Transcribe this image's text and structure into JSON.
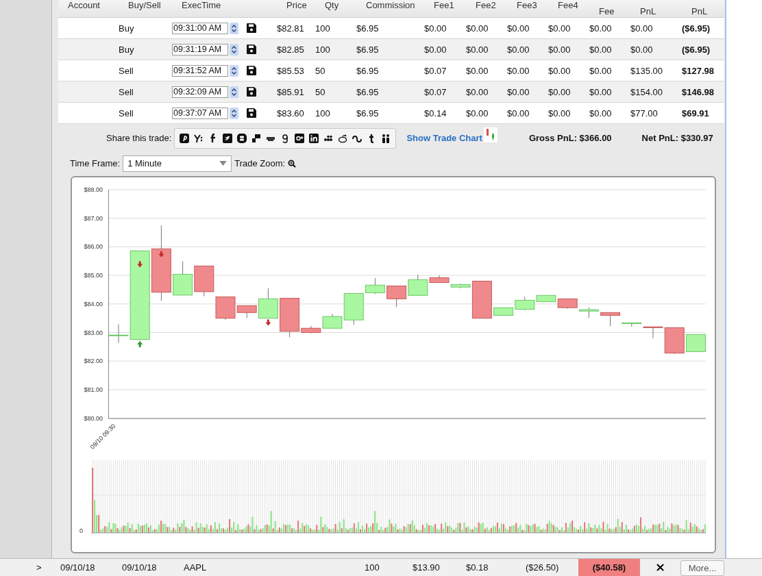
{
  "trades_table": {
    "columns": [
      "Account",
      "Buy/Sell",
      "ExecTime",
      "Price",
      "Qty",
      "Commission",
      "Fee1",
      "Fee2",
      "Fee3",
      "Fee4",
      "Fee",
      "PnL",
      "PnL"
    ],
    "rows": [
      {
        "side": "Buy",
        "time": "09:31:00 AM",
        "price": "$82.81",
        "qty": "100",
        "commission": "$6.95",
        "fee1": "$0.00",
        "fee2": "$0.00",
        "fee3": "$0.00",
        "fee4": "$0.00",
        "fee": "$0.00",
        "pnl": "$0.00",
        "net_pnl": "($6.95)"
      },
      {
        "side": "Buy",
        "time": "09:31:19 AM",
        "price": "$82.85",
        "qty": "100",
        "commission": "$6.95",
        "fee1": "$0.00",
        "fee2": "$0.00",
        "fee3": "$0.00",
        "fee4": "$0.00",
        "fee": "$0.00",
        "pnl": "$0.00",
        "net_pnl": "($6.95)"
      },
      {
        "side": "Sell",
        "time": "09:31:52 AM",
        "price": "$85.53",
        "qty": "50",
        "commission": "$6.95",
        "fee1": "$0.07",
        "fee2": "$0.00",
        "fee3": "$0.00",
        "fee4": "$0.00",
        "fee": "$0.00",
        "pnl": "$135.00",
        "net_pnl": "$127.98"
      },
      {
        "side": "Sell",
        "time": "09:32:09 AM",
        "price": "$85.91",
        "qty": "50",
        "commission": "$6.95",
        "fee1": "$0.07",
        "fee2": "$0.00",
        "fee3": "$0.00",
        "fee4": "$0.00",
        "fee": "$0.00",
        "pnl": "$154.00",
        "net_pnl": "$146.98"
      },
      {
        "side": "Sell",
        "time": "09:37:07 AM",
        "price": "$83.60",
        "qty": "100",
        "commission": "$6.95",
        "fee1": "$0.14",
        "fee2": "$0.00",
        "fee3": "$0.00",
        "fee4": "$0.00",
        "fee": "$0.00",
        "pnl": "$77.00",
        "net_pnl": "$69.91"
      }
    ]
  },
  "share": {
    "label": "Share this trade:",
    "show_chart_link": "Show Trade Chart",
    "gross_pnl": "Gross PnL: $366.00",
    "net_pnl": "Net PnL: $330.97"
  },
  "controls": {
    "time_frame_label": "Time Frame:",
    "time_frame": "1 Minute",
    "trade_zoom_label": "Trade Zoom:"
  },
  "price_chart": {
    "chart_data": {
      "type": "candlestick",
      "ylim": [
        80,
        88
      ],
      "yticks": [
        {
          "value": 88,
          "label": "$88.00"
        },
        {
          "value": 87,
          "label": "$87.00"
        },
        {
          "value": 86,
          "label": "$86.00"
        },
        {
          "value": 85,
          "label": "$85.00"
        },
        {
          "value": 84,
          "label": "$84.00"
        },
        {
          "value": 83,
          "label": "$83.00"
        },
        {
          "value": 82,
          "label": "$82.00"
        },
        {
          "value": 81,
          "label": "$81.00"
        },
        {
          "value": 80,
          "label": "$80.00"
        }
      ],
      "grid": true,
      "categories": [
        "09/10 09:30",
        null,
        null,
        null,
        null,
        null,
        null,
        null,
        null,
        null,
        null,
        null,
        null,
        null,
        null,
        null,
        null,
        null,
        null,
        null,
        null,
        null,
        null,
        null,
        null,
        null,
        null,
        null
      ],
      "ohlc": [
        [
          82.91,
          83.29,
          82.64,
          82.91
        ],
        [
          82.76,
          85.86,
          82.72,
          85.86
        ],
        [
          85.93,
          86.75,
          84.11,
          84.41
        ],
        [
          84.31,
          85.49,
          84.31,
          85.04
        ],
        [
          85.33,
          85.33,
          84.27,
          84.43
        ],
        [
          84.25,
          84.25,
          83.44,
          83.5
        ],
        [
          83.94,
          83.94,
          83.51,
          83.7
        ],
        [
          83.5,
          84.55,
          83.5,
          84.18
        ],
        [
          84.2,
          84.2,
          82.84,
          83.04
        ],
        [
          83.15,
          83.23,
          82.97,
          83.0
        ],
        [
          83.15,
          83.65,
          83.15,
          83.56
        ],
        [
          83.44,
          84.37,
          83.27,
          84.37
        ],
        [
          84.39,
          84.91,
          84.35,
          84.66
        ],
        [
          84.63,
          84.63,
          83.89,
          84.18
        ],
        [
          84.3,
          85.03,
          84.3,
          84.85
        ],
        [
          84.92,
          85.0,
          84.75,
          84.75
        ],
        [
          84.59,
          84.71,
          84.55,
          84.68
        ],
        [
          84.8,
          84.8,
          83.5,
          83.5
        ],
        [
          83.6,
          83.87,
          83.6,
          83.87
        ],
        [
          83.81,
          84.25,
          83.78,
          84.13
        ],
        [
          84.08,
          84.3,
          84.08,
          84.3
        ],
        [
          84.18,
          84.18,
          83.83,
          83.87
        ],
        [
          83.75,
          83.87,
          83.51,
          83.8
        ],
        [
          83.7,
          83.7,
          83.22,
          83.6
        ],
        [
          83.31,
          83.34,
          83.2,
          83.34
        ],
        [
          83.2,
          83.2,
          82.8,
          83.17
        ],
        [
          83.17,
          83.17,
          82.25,
          82.28
        ],
        [
          82.33,
          82.93,
          82.33,
          82.93
        ]
      ]
    },
    "volume_label": "0"
  },
  "next_trade": {
    "expand": ">",
    "open_date": "09/10/18",
    "close_date": "09/10/18",
    "symbol": "AAPL",
    "qty": "100",
    "price": "$13.90",
    "fees": "$0.18",
    "pnl": "($26.50)",
    "net_pnl": "($40.58)",
    "loss": true,
    "delete": "×",
    "more": "More..."
  }
}
